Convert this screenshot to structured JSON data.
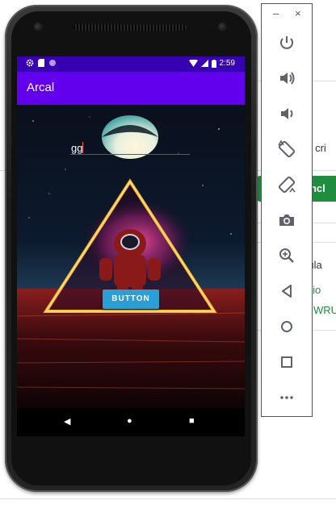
{
  "background_page": {
    "text_1": "ou cri",
    "button_label": "oncl",
    "text_2": "icula",
    "text_3": "tário",
    "text_4": "WRU"
  },
  "phone": {
    "status_bar": {
      "time": "2:59"
    },
    "app_bar": {
      "title": "Arcal"
    },
    "edit_text": {
      "value": "gg"
    },
    "button": {
      "label": "BUTTON"
    },
    "nav": {
      "back": "◀",
      "home": "●",
      "recents": "■"
    }
  },
  "emulator_toolbar": {
    "minimize": "–",
    "close": "×",
    "items": [
      "power-icon",
      "volume-up-icon",
      "volume-down-icon",
      "rotate-left-icon",
      "rotate-right-icon",
      "camera-icon",
      "zoom-icon",
      "back-icon",
      "home-icon",
      "overview-icon",
      "more-icon"
    ]
  },
  "colors": {
    "status_bar": "#3700b3",
    "app_bar": "#6200ee",
    "accent_button": "#2a9fd6",
    "edit_underline": "#d81b60",
    "page_green": "#1e8e3e"
  }
}
